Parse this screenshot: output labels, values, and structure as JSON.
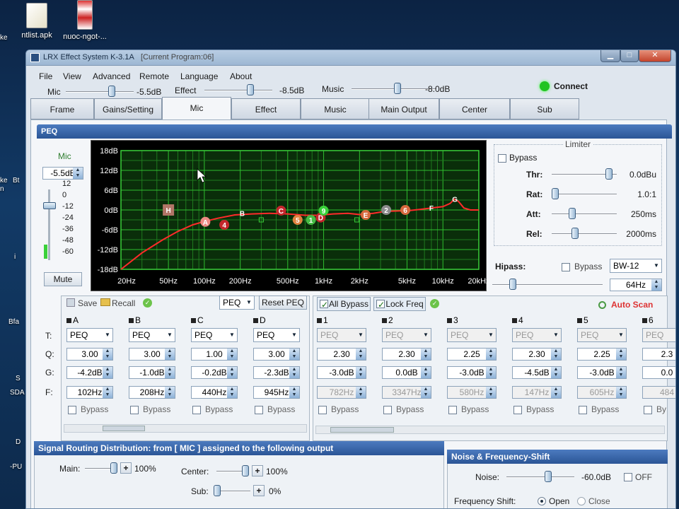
{
  "desktop": {
    "icons": [
      {
        "label": "ntlist.apk"
      },
      {
        "label": "nuoc-ngot-..."
      }
    ],
    "edge_labels": [
      "ke",
      "Bt",
      "ke",
      "n",
      "i",
      "Bfa",
      "S",
      "SDA",
      "D",
      "-PU"
    ]
  },
  "window": {
    "title": "LRX Effect System K-3.1A",
    "program": "[Current Program:06]",
    "controls": {
      "minimize": "▁",
      "maximize": "□",
      "close": "✕"
    }
  },
  "menu": [
    "File",
    "View",
    "Advanced",
    "Remote",
    "Language",
    "About"
  ],
  "top_levels": {
    "mic": {
      "label": "Mic",
      "value": "-5.5dB",
      "level": 0.48
    },
    "effect": {
      "label": "Effect",
      "value": "-8.5dB",
      "level": 0.55
    },
    "music": {
      "label": "Music",
      "value": "-8.0dB",
      "level": 0.62
    },
    "connect": {
      "label": "Connect",
      "color": "#22c322"
    }
  },
  "tabs": [
    "Frame",
    "Gains/Setting",
    "Mic",
    "Effect",
    "Music",
    "Main Output",
    "Center",
    "Sub"
  ],
  "active_tab": "Mic",
  "peq": {
    "title": "PEQ",
    "mic_label": "Mic",
    "mic_value": "-5.5dB",
    "meter_ticks": [
      "12",
      "0",
      "-12",
      "-24",
      "-36",
      "-48",
      "-60"
    ],
    "mute": "Mute"
  },
  "chart_data": {
    "type": "line",
    "title": "",
    "xlabel": "",
    "ylabel": "",
    "x_scale": "log",
    "x_ticks": [
      "20Hz",
      "50Hz",
      "100Hz",
      "200Hz",
      "500Hz",
      "1kHz",
      "2kHz",
      "5kHz",
      "10kHz",
      "20kHz"
    ],
    "x_tick_values": [
      20,
      50,
      100,
      200,
      500,
      1000,
      2000,
      5000,
      10000,
      20000
    ],
    "y_ticks": [
      "18dB",
      "12dB",
      "6dB",
      "0dB",
      "-6dB",
      "-12dB",
      "-18dB"
    ],
    "y_tick_values": [
      18,
      12,
      6,
      0,
      -6,
      -12,
      -18
    ],
    "ylim": [
      -18,
      18
    ],
    "xlim": [
      20,
      20000
    ],
    "grid": true,
    "curve": [
      [
        20,
        -18
      ],
      [
        30,
        -13
      ],
      [
        45,
        -9
      ],
      [
        60,
        -6.5
      ],
      [
        80,
        -4.5
      ],
      [
        100,
        -3.5
      ],
      [
        130,
        -2.5
      ],
      [
        180,
        -1.5
      ],
      [
        250,
        -1.2
      ],
      [
        350,
        -1
      ],
      [
        500,
        -1.2
      ],
      [
        700,
        -1.6
      ],
      [
        900,
        -1.6
      ],
      [
        1200,
        -1.2
      ],
      [
        1600,
        -1
      ],
      [
        2000,
        -1.4
      ],
      [
        2600,
        -1
      ],
      [
        3300,
        -0.4
      ],
      [
        4200,
        -0.3
      ],
      [
        5200,
        -0.2
      ],
      [
        6500,
        0.2
      ],
      [
        8000,
        0.6
      ],
      [
        10000,
        1
      ],
      [
        11500,
        2
      ],
      [
        12500,
        3.3
      ],
      [
        13500,
        2.6
      ],
      [
        15000,
        0.6
      ],
      [
        17000,
        0
      ],
      [
        20000,
        0
      ]
    ],
    "points": [
      {
        "label": "H",
        "freq": 50,
        "gain": 0,
        "color": "#b07566",
        "shape": "square"
      },
      {
        "label": "A",
        "freq": 102,
        "gain": -3.6,
        "color": "#ee8b84",
        "shape": "circle"
      },
      {
        "label": "4",
        "freq": 147,
        "gain": -4.5,
        "color": "#c4262c",
        "shape": "circle"
      },
      {
        "label": "B",
        "freq": 208,
        "gain": -1,
        "color": "#d23236",
        "shape": "none"
      },
      {
        "label": "C",
        "freq": 440,
        "gain": -0.2,
        "color": "#c4262c",
        "shape": "circle"
      },
      {
        "label": "5",
        "freq": 605,
        "gain": -3,
        "color": "#e1823f",
        "shape": "circle"
      },
      {
        "label": "1",
        "freq": 782,
        "gain": -3,
        "color": "#46bb44",
        "shape": "circle"
      },
      {
        "label": "D",
        "freq": 945,
        "gain": -2.3,
        "color": "#c4262c",
        "shape": "circle"
      },
      {
        "label": "9",
        "freq": 1000,
        "gain": -0.2,
        "color": "#3ad13a",
        "shape": "circle"
      },
      {
        "label": "E",
        "freq": 2250,
        "gain": -1.5,
        "color": "#d7693d",
        "shape": "circle"
      },
      {
        "label": "2",
        "freq": 3347,
        "gain": 0,
        "color": "#8a8a8a",
        "shape": "circle"
      },
      {
        "label": "6",
        "freq": 4840,
        "gain": 0,
        "color": "#d7693d",
        "shape": "circle"
      },
      {
        "label": "F",
        "freq": 8000,
        "gain": 0.6,
        "color": "#ffffff",
        "shape": "none"
      },
      {
        "label": "G",
        "freq": 12600,
        "gain": 3.3,
        "color": "#ffffff",
        "shape": "none"
      },
      {
        "label": "",
        "freq": 300,
        "gain": -3,
        "color": "#3ad13a",
        "shape": "hollow"
      },
      {
        "label": "",
        "freq": 1900,
        "gain": -3,
        "color": "#3ad13a",
        "shape": "hollow"
      }
    ]
  },
  "limiter": {
    "title": "Limiter",
    "bypass": "Bypass",
    "rows": [
      {
        "label": "Thr:",
        "value": "0.0dBu",
        "level": 0.95
      },
      {
        "label": "Rat:",
        "value": "1.0:1",
        "level": 0.0
      },
      {
        "label": "Att:",
        "value": "250ms",
        "level": 0.3
      },
      {
        "label": "Rel:",
        "value": "2000ms",
        "level": 0.35
      }
    ],
    "hipass": {
      "label": "Hipass:",
      "bypass": "Bypass",
      "type": "BW-12",
      "freq": "64Hz",
      "level": 0.15
    }
  },
  "left_bands": {
    "toolbar": {
      "save": "Save",
      "recall": "Recall",
      "mode": "PEQ",
      "reset": "Reset PEQ"
    },
    "row_labels": {
      "t": "T:",
      "q": "Q:",
      "g": "G:",
      "f": "F:"
    },
    "bands": [
      {
        "name": "A",
        "type": "PEQ",
        "q": "3.00",
        "gain": "-4.2dB",
        "freq": "102Hz",
        "bypass": "Bypass"
      },
      {
        "name": "B",
        "type": "PEQ",
        "q": "3.00",
        "gain": "-1.0dB",
        "freq": "208Hz",
        "bypass": "Bypass"
      },
      {
        "name": "C",
        "type": "PEQ",
        "q": "1.00",
        "gain": "-0.2dB",
        "freq": "440Hz",
        "bypass": "Bypass"
      },
      {
        "name": "D",
        "type": "PEQ",
        "q": "3.00",
        "gain": "-2.3dB",
        "freq": "945Hz",
        "bypass": "Bypass"
      }
    ]
  },
  "right_bands": {
    "toolbar": {
      "all_bypass": "All Bypass",
      "lock_freq": "Lock Freq",
      "auto_scan": "Auto Scan"
    },
    "bands": [
      {
        "name": "1",
        "type": "PEQ",
        "q": "2.30",
        "gain": "-3.0dB",
        "freq": "782Hz",
        "bypass": "Bypass"
      },
      {
        "name": "2",
        "type": "PEQ",
        "q": "2.30",
        "gain": "0.0dB",
        "freq": "3347Hz",
        "bypass": "Bypass"
      },
      {
        "name": "3",
        "type": "PEQ",
        "q": "2.25",
        "gain": "-3.0dB",
        "freq": "580Hz",
        "bypass": "Bypass"
      },
      {
        "name": "4",
        "type": "PEQ",
        "q": "2.30",
        "gain": "-4.5dB",
        "freq": "147Hz",
        "bypass": "Bypass"
      },
      {
        "name": "5",
        "type": "PEQ",
        "q": "2.25",
        "gain": "-3.0dB",
        "freq": "605Hz",
        "bypass": "Bypass"
      },
      {
        "name": "6",
        "type": "PEQ",
        "q": "2.3",
        "gain": "0.0",
        "freq": "484",
        "bypass": "By"
      }
    ]
  },
  "routing": {
    "title": "Signal Routing Distribution: from [ MIC ] assigned to the following output",
    "main": {
      "label": "Main:",
      "value": "100%",
      "level": 1.0
    },
    "center": {
      "label": "Center:",
      "value": "100%",
      "level": 1.0
    },
    "sub": {
      "label": "Sub:",
      "value": "0%",
      "level": 0.0
    }
  },
  "noise": {
    "title": "Noise & Frequency-Shift",
    "noise_label": "Noise:",
    "noise_value": "-60.0dB",
    "off_label": "OFF",
    "shift_label": "Frequency Shift:",
    "open": "Open",
    "close": "Close"
  }
}
